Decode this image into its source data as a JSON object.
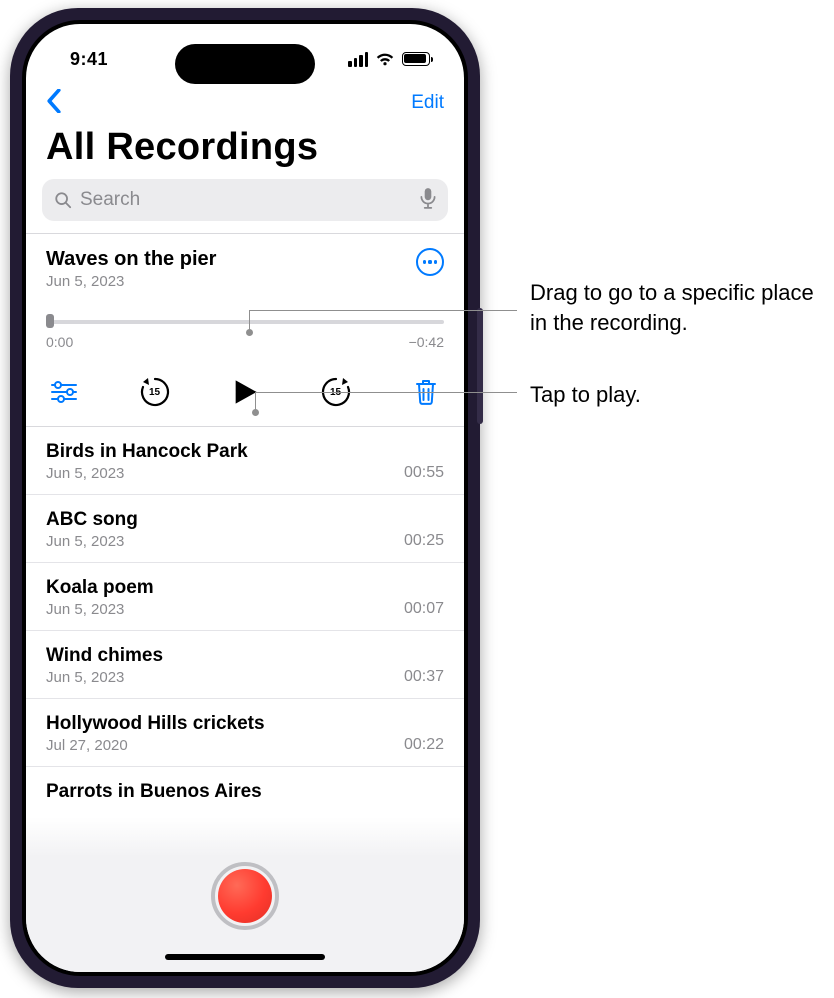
{
  "status": {
    "time": "9:41"
  },
  "nav": {
    "edit": "Edit"
  },
  "title": "All Recordings",
  "search": {
    "placeholder": "Search"
  },
  "expanded": {
    "title": "Waves on the pier",
    "date": "Jun 5, 2023",
    "elapsed": "0:00",
    "remaining": "−0:42",
    "skip_amount": "15"
  },
  "recordings": [
    {
      "title": "Birds in Hancock Park",
      "date": "Jun 5, 2023",
      "duration": "00:55"
    },
    {
      "title": "ABC song",
      "date": "Jun 5, 2023",
      "duration": "00:25"
    },
    {
      "title": "Koala poem",
      "date": "Jun 5, 2023",
      "duration": "00:07"
    },
    {
      "title": "Wind chimes",
      "date": "Jun 5, 2023",
      "duration": "00:37"
    },
    {
      "title": "Hollywood Hills crickets",
      "date": "Jul 27, 2020",
      "duration": "00:22"
    }
  ],
  "partial": {
    "title": "Parrots in Buenos Aires"
  },
  "callouts": {
    "scrubber": "Drag to go to a specific place in the recording.",
    "play": "Tap to play."
  }
}
